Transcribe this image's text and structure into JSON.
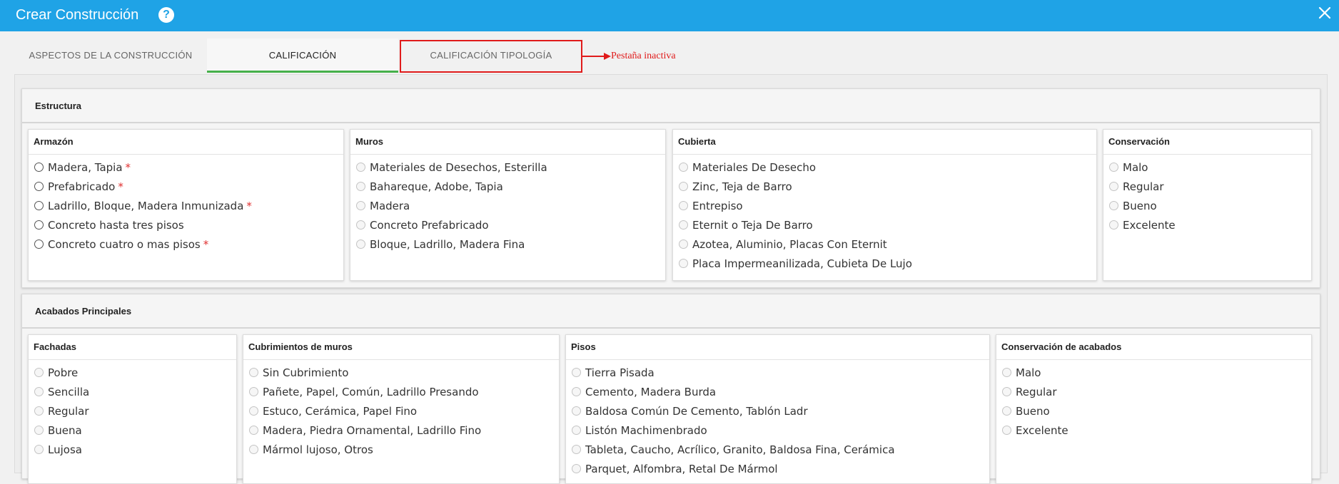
{
  "window": {
    "title": "Crear Construcción",
    "help_icon": "?"
  },
  "tabs": [
    {
      "label": "ASPECTOS DE LA CONSTRUCCIÓN"
    },
    {
      "label": "CALIFICACIÓN"
    },
    {
      "label": "CALIFICACIÓN TIPOLOGÍA"
    }
  ],
  "annotation": {
    "text": "Pestaña inactiva",
    "color": "#e01b1b"
  },
  "colors": {
    "titlebar": "#1fa3e6",
    "active_tab_underline": "#46b04a",
    "required_star": "#e03030"
  },
  "sections": [
    {
      "title": "Estructura",
      "cards": [
        {
          "title": "Armazón",
          "enabled": true,
          "options": [
            {
              "label": "Madera, Tapia",
              "required": true
            },
            {
              "label": "Prefabricado",
              "required": true
            },
            {
              "label": "Ladrillo, Bloque, Madera Inmunizada",
              "required": true
            },
            {
              "label": "Concreto hasta tres pisos",
              "required": false
            },
            {
              "label": "Concreto cuatro o mas pisos",
              "required": true
            }
          ]
        },
        {
          "title": "Muros",
          "enabled": false,
          "options": [
            {
              "label": "Materiales de Desechos, Esterilla"
            },
            {
              "label": "Bahareque, Adobe, Tapia"
            },
            {
              "label": "Madera"
            },
            {
              "label": "Concreto Prefabricado"
            },
            {
              "label": "Bloque, Ladrillo, Madera Fina"
            }
          ]
        },
        {
          "title": "Cubierta",
          "enabled": false,
          "options": [
            {
              "label": "Materiales De Desecho"
            },
            {
              "label": "Zinc, Teja de Barro"
            },
            {
              "label": "Entrepiso"
            },
            {
              "label": "Eternit o Teja De Barro"
            },
            {
              "label": "Azotea, Aluminio, Placas Con Eternit"
            },
            {
              "label": "Placa Impermeanilizada, Cubieta De Lujo"
            }
          ]
        },
        {
          "title": "Conservación",
          "enabled": false,
          "options": [
            {
              "label": "Malo"
            },
            {
              "label": "Regular"
            },
            {
              "label": "Bueno"
            },
            {
              "label": "Excelente"
            }
          ]
        }
      ]
    },
    {
      "title": "Acabados Principales",
      "cards": [
        {
          "title": "Fachadas",
          "enabled": false,
          "options": [
            {
              "label": "Pobre"
            },
            {
              "label": "Sencilla"
            },
            {
              "label": "Regular"
            },
            {
              "label": "Buena"
            },
            {
              "label": "Lujosa"
            }
          ]
        },
        {
          "title": "Cubrimientos de muros",
          "enabled": false,
          "options": [
            {
              "label": "Sin Cubrimiento"
            },
            {
              "label": "Pañete, Papel, Común, Ladrillo Presando"
            },
            {
              "label": "Estuco, Cerámica, Papel Fino"
            },
            {
              "label": "Madera, Piedra Ornamental, Ladrillo Fino"
            },
            {
              "label": "Mármol lujoso, Otros"
            }
          ]
        },
        {
          "title": "Pisos",
          "enabled": false,
          "options": [
            {
              "label": "Tierra Pisada"
            },
            {
              "label": "Cemento, Madera Burda"
            },
            {
              "label": "Baldosa Común De Cemento, Tablón Ladr"
            },
            {
              "label": "Listón Machimenbrado"
            },
            {
              "label": "Tableta, Caucho, Acrílico, Granito, Baldosa Fina, Cerámica"
            },
            {
              "label": "Parquet, Alfombra, Retal De Mármol"
            }
          ]
        },
        {
          "title": "Conservación de acabados",
          "enabled": false,
          "options": [
            {
              "label": "Malo"
            },
            {
              "label": "Regular"
            },
            {
              "label": "Bueno"
            },
            {
              "label": "Excelente"
            }
          ]
        }
      ]
    }
  ]
}
